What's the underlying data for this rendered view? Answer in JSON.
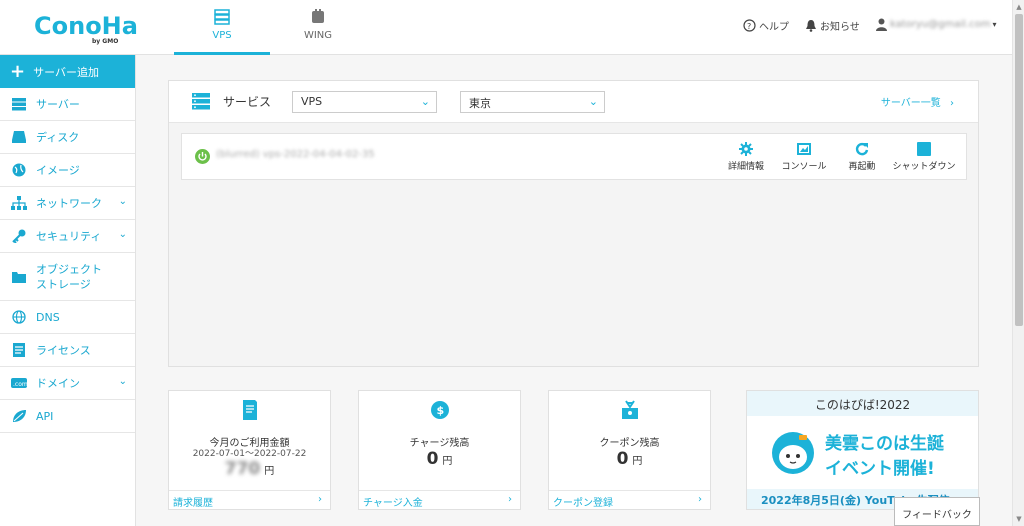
{
  "brand": {
    "logo_text": "ConoHa",
    "logo_sub": "by GMO",
    "accent": "#1cb2d8"
  },
  "top_tabs": [
    {
      "label": "VPS",
      "icon": "server-icon",
      "active": true
    },
    {
      "label": "WING",
      "icon": "wing-icon",
      "active": false
    }
  ],
  "header": {
    "help_label": "ヘルプ",
    "notice_label": "お知らせ",
    "account_label": "katoryu@gmail.com"
  },
  "sidebar": {
    "add_label": "サーバー追加",
    "items": [
      {
        "label": "サーバー",
        "icon": "server-icon"
      },
      {
        "label": "ディスク",
        "icon": "disk-icon"
      },
      {
        "label": "イメージ",
        "icon": "globe-icon"
      },
      {
        "label": "ネットワーク",
        "icon": "network-icon",
        "expandable": true
      },
      {
        "label": "セキュリティ",
        "icon": "key-icon",
        "expandable": true
      },
      {
        "label": "オブジェクト\nストレージ",
        "icon": "folder-icon"
      },
      {
        "label": "DNS",
        "icon": "dns-globe-icon"
      },
      {
        "label": "ライセンス",
        "icon": "license-icon"
      },
      {
        "label": "ドメイン",
        "icon": "domain-icon",
        "expandable": true
      },
      {
        "label": "API",
        "icon": "api-leaf-icon"
      }
    ]
  },
  "services": {
    "title": "サービス",
    "type_select": "VPS",
    "region_select": "東京",
    "server_list_link": "サーバー一覧",
    "server": {
      "name": "(blurred) vps-2022-04-04-02-35",
      "status": "running",
      "status_color": "#6cc04a"
    },
    "actions": [
      {
        "label": "詳細情報",
        "icon": "gear-icon"
      },
      {
        "label": "コンソール",
        "icon": "console-icon"
      },
      {
        "label": "再起動",
        "icon": "restart-icon"
      },
      {
        "label": "シャットダウン",
        "icon": "shutdown-icon"
      }
    ]
  },
  "cards": [
    {
      "title": "今月のご利用金額",
      "date_range": "2022-07-01～2022-07-22",
      "value": "770",
      "value_blurred": true,
      "unit": "円",
      "footer": "請求履歴",
      "icon": "invoice-icon"
    },
    {
      "title": "チャージ残高",
      "value": "0",
      "unit": "円",
      "footer": "チャージ入金",
      "icon": "dollar-coin-icon"
    },
    {
      "title": "クーポン残高",
      "value": "0",
      "unit": "円",
      "footer": "クーポン登録",
      "icon": "coupon-icon"
    }
  ],
  "banner": {
    "head": "このはぴば!2022",
    "line1": "美雲このは生誕",
    "line2": "イベント開催!",
    "footer": "2022年8月5日(金) YouTube生配信"
  },
  "feedback_label": "フィードバック"
}
